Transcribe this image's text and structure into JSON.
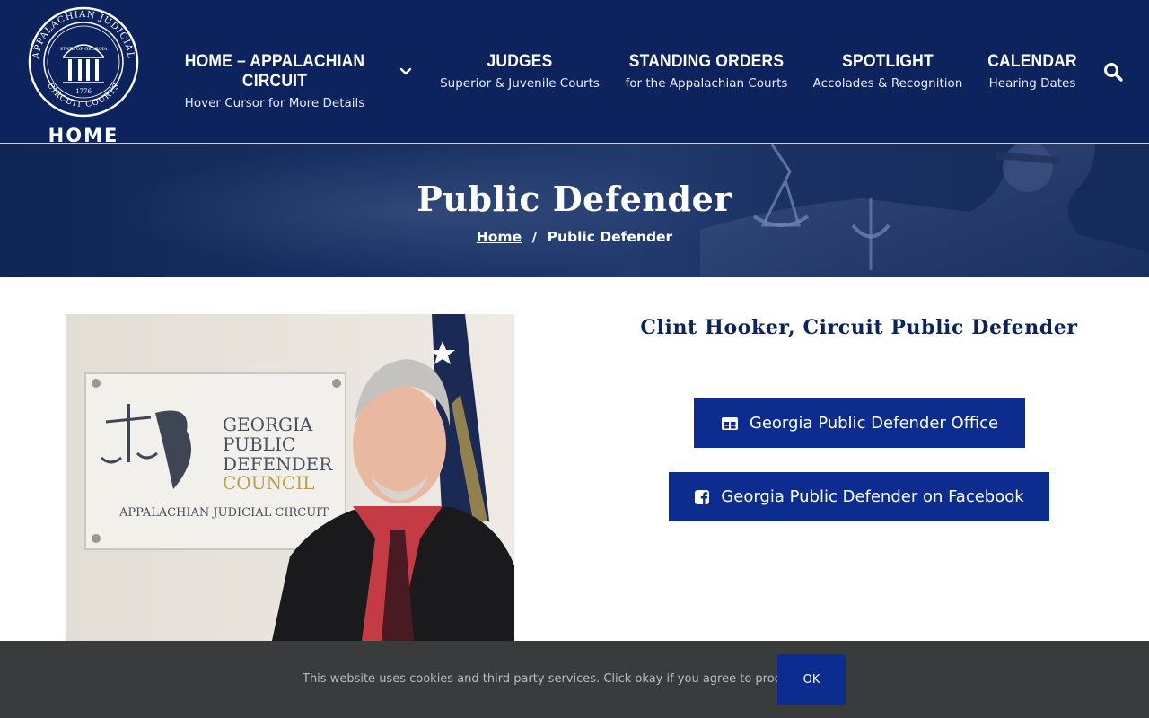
{
  "header": {
    "logo": {
      "seal_ring_text_top": "APPALACHIAN JUDICIAL",
      "seal_inner_text": "STATE OF GEORGIA",
      "seal_ring_text_bottom": "CIRCUIT COURTS",
      "seal_year": "1776",
      "home_label": "HOME"
    },
    "nav": [
      {
        "title": "HOME – APPALACHIAN CIRCUIT",
        "subtitle": "Hover Cursor for More Details",
        "has_dropdown": true
      },
      {
        "title": "JUDGES",
        "subtitle": "Superior & Juvenile Courts"
      },
      {
        "title": "STANDING ORDERS",
        "subtitle": "for the Appalachian Courts"
      },
      {
        "title": "SPOTLIGHT",
        "subtitle": "Accolades & Recognition"
      },
      {
        "title": "CALENDAR",
        "subtitle": "Hearing Dates"
      }
    ],
    "search_icon": "search-icon",
    "background_color": "#0c235e"
  },
  "hero": {
    "title": "Public Defender",
    "breadcrumb": {
      "home": "Home",
      "separator": "/",
      "current": "Public Defender"
    }
  },
  "main": {
    "photo": {
      "sign_line1": "GEORGIA",
      "sign_line2": "PUBLIC",
      "sign_line3": "DEFENDER",
      "sign_line4": "COUNCIL",
      "sign_line5": "APPALACHIAN JUDICIAL CIRCUIT"
    },
    "heading": "Clint Hooker, Circuit Public Defender",
    "buttons": [
      {
        "label": "Georgia Public Defender Office",
        "icon": "table-icon"
      },
      {
        "label": "Georgia Public Defender on Facebook",
        "icon": "facebook-icon"
      }
    ],
    "button_color": "#0c2d8f"
  },
  "cookie_bar": {
    "message": "This website uses cookies and third party services. Click okay if you agree to proceed.",
    "ok_label": "OK"
  }
}
